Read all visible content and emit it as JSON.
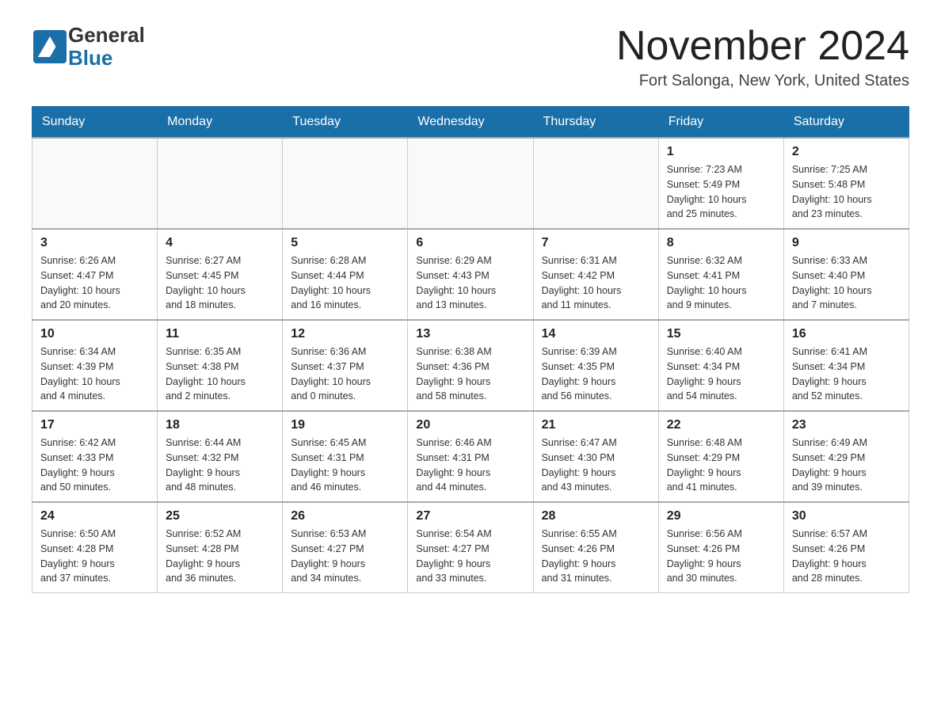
{
  "header": {
    "logo_general": "General",
    "logo_blue": "Blue",
    "month_title": "November 2024",
    "location": "Fort Salonga, New York, United States"
  },
  "weekdays": [
    "Sunday",
    "Monday",
    "Tuesday",
    "Wednesday",
    "Thursday",
    "Friday",
    "Saturday"
  ],
  "weeks": [
    [
      {
        "day": "",
        "info": ""
      },
      {
        "day": "",
        "info": ""
      },
      {
        "day": "",
        "info": ""
      },
      {
        "day": "",
        "info": ""
      },
      {
        "day": "",
        "info": ""
      },
      {
        "day": "1",
        "info": "Sunrise: 7:23 AM\nSunset: 5:49 PM\nDaylight: 10 hours\nand 25 minutes."
      },
      {
        "day": "2",
        "info": "Sunrise: 7:25 AM\nSunset: 5:48 PM\nDaylight: 10 hours\nand 23 minutes."
      }
    ],
    [
      {
        "day": "3",
        "info": "Sunrise: 6:26 AM\nSunset: 4:47 PM\nDaylight: 10 hours\nand 20 minutes."
      },
      {
        "day": "4",
        "info": "Sunrise: 6:27 AM\nSunset: 4:45 PM\nDaylight: 10 hours\nand 18 minutes."
      },
      {
        "day": "5",
        "info": "Sunrise: 6:28 AM\nSunset: 4:44 PM\nDaylight: 10 hours\nand 16 minutes."
      },
      {
        "day": "6",
        "info": "Sunrise: 6:29 AM\nSunset: 4:43 PM\nDaylight: 10 hours\nand 13 minutes."
      },
      {
        "day": "7",
        "info": "Sunrise: 6:31 AM\nSunset: 4:42 PM\nDaylight: 10 hours\nand 11 minutes."
      },
      {
        "day": "8",
        "info": "Sunrise: 6:32 AM\nSunset: 4:41 PM\nDaylight: 10 hours\nand 9 minutes."
      },
      {
        "day": "9",
        "info": "Sunrise: 6:33 AM\nSunset: 4:40 PM\nDaylight: 10 hours\nand 7 minutes."
      }
    ],
    [
      {
        "day": "10",
        "info": "Sunrise: 6:34 AM\nSunset: 4:39 PM\nDaylight: 10 hours\nand 4 minutes."
      },
      {
        "day": "11",
        "info": "Sunrise: 6:35 AM\nSunset: 4:38 PM\nDaylight: 10 hours\nand 2 minutes."
      },
      {
        "day": "12",
        "info": "Sunrise: 6:36 AM\nSunset: 4:37 PM\nDaylight: 10 hours\nand 0 minutes."
      },
      {
        "day": "13",
        "info": "Sunrise: 6:38 AM\nSunset: 4:36 PM\nDaylight: 9 hours\nand 58 minutes."
      },
      {
        "day": "14",
        "info": "Sunrise: 6:39 AM\nSunset: 4:35 PM\nDaylight: 9 hours\nand 56 minutes."
      },
      {
        "day": "15",
        "info": "Sunrise: 6:40 AM\nSunset: 4:34 PM\nDaylight: 9 hours\nand 54 minutes."
      },
      {
        "day": "16",
        "info": "Sunrise: 6:41 AM\nSunset: 4:34 PM\nDaylight: 9 hours\nand 52 minutes."
      }
    ],
    [
      {
        "day": "17",
        "info": "Sunrise: 6:42 AM\nSunset: 4:33 PM\nDaylight: 9 hours\nand 50 minutes."
      },
      {
        "day": "18",
        "info": "Sunrise: 6:44 AM\nSunset: 4:32 PM\nDaylight: 9 hours\nand 48 minutes."
      },
      {
        "day": "19",
        "info": "Sunrise: 6:45 AM\nSunset: 4:31 PM\nDaylight: 9 hours\nand 46 minutes."
      },
      {
        "day": "20",
        "info": "Sunrise: 6:46 AM\nSunset: 4:31 PM\nDaylight: 9 hours\nand 44 minutes."
      },
      {
        "day": "21",
        "info": "Sunrise: 6:47 AM\nSunset: 4:30 PM\nDaylight: 9 hours\nand 43 minutes."
      },
      {
        "day": "22",
        "info": "Sunrise: 6:48 AM\nSunset: 4:29 PM\nDaylight: 9 hours\nand 41 minutes."
      },
      {
        "day": "23",
        "info": "Sunrise: 6:49 AM\nSunset: 4:29 PM\nDaylight: 9 hours\nand 39 minutes."
      }
    ],
    [
      {
        "day": "24",
        "info": "Sunrise: 6:50 AM\nSunset: 4:28 PM\nDaylight: 9 hours\nand 37 minutes."
      },
      {
        "day": "25",
        "info": "Sunrise: 6:52 AM\nSunset: 4:28 PM\nDaylight: 9 hours\nand 36 minutes."
      },
      {
        "day": "26",
        "info": "Sunrise: 6:53 AM\nSunset: 4:27 PM\nDaylight: 9 hours\nand 34 minutes."
      },
      {
        "day": "27",
        "info": "Sunrise: 6:54 AM\nSunset: 4:27 PM\nDaylight: 9 hours\nand 33 minutes."
      },
      {
        "day": "28",
        "info": "Sunrise: 6:55 AM\nSunset: 4:26 PM\nDaylight: 9 hours\nand 31 minutes."
      },
      {
        "day": "29",
        "info": "Sunrise: 6:56 AM\nSunset: 4:26 PM\nDaylight: 9 hours\nand 30 minutes."
      },
      {
        "day": "30",
        "info": "Sunrise: 6:57 AM\nSunset: 4:26 PM\nDaylight: 9 hours\nand 28 minutes."
      }
    ]
  ]
}
